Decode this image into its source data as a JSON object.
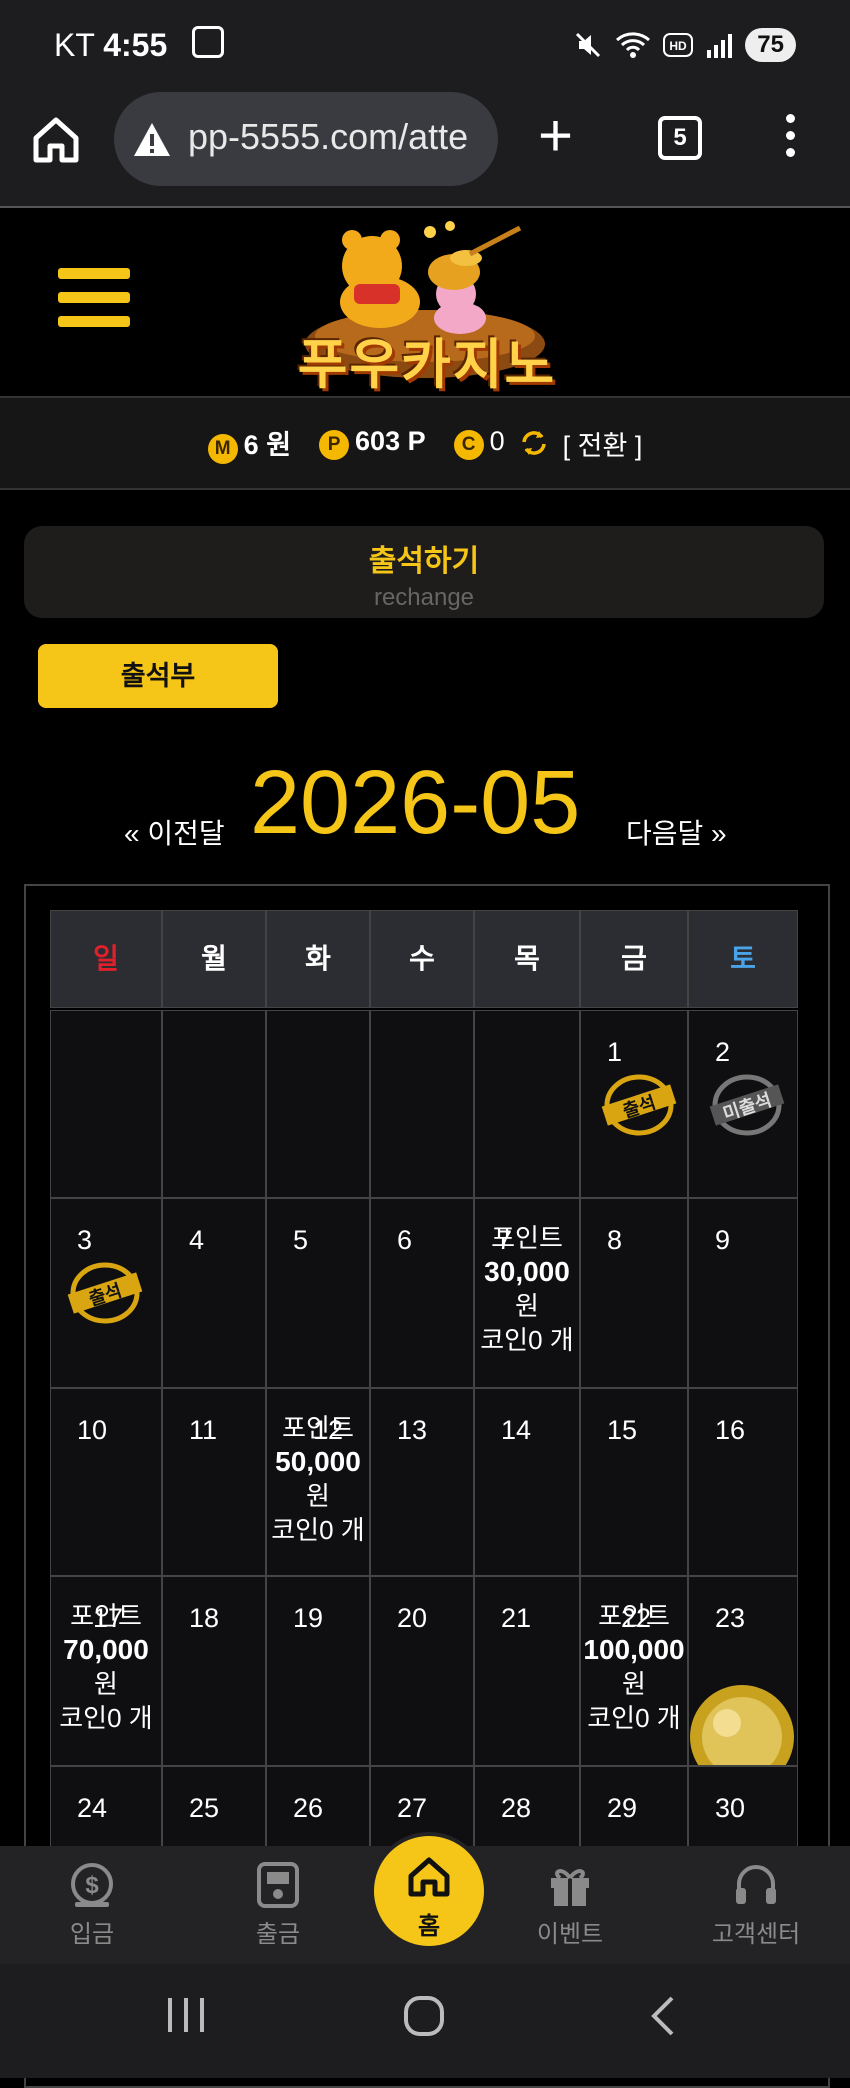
{
  "status_bar": {
    "carrier": "KT",
    "time": "4:55",
    "battery": "75"
  },
  "browser": {
    "url": "pp-5555.com/atte",
    "tab_count": "5"
  },
  "site": {
    "logo_text": "푸우카지노"
  },
  "balance": {
    "money_badge": "M",
    "money_value": "6",
    "money_unit": "원",
    "point_badge": "P",
    "point_value": "603",
    "point_unit": "P",
    "coin_badge": "C",
    "coin_value": "0",
    "switch_label": "[ 전환 ]"
  },
  "attendance": {
    "title": "출석하기",
    "subtitle": "rechange",
    "button_label": "출석부"
  },
  "month_nav": {
    "prev": "« 이전달",
    "current": "2026-05",
    "next": "다음달 »"
  },
  "calendar": {
    "weekdays": [
      "일",
      "월",
      "화",
      "수",
      "목",
      "금",
      "토"
    ],
    "days": {
      "d1": "1",
      "d2": "2",
      "d3": "3",
      "d4": "4",
      "d5": "5",
      "d6": "6",
      "d7": "7",
      "d8": "8",
      "d9": "9",
      "d10": "10",
      "d11": "11",
      "d12": "12",
      "d13": "13",
      "d14": "14",
      "d15": "15",
      "d16": "16",
      "d17": "17",
      "d18": "18",
      "d19": "19",
      "d20": "20",
      "d21": "21",
      "d22": "22",
      "d23": "23",
      "d24": "24",
      "d25": "25",
      "d26": "26",
      "d27": "27",
      "d28": "28",
      "d29": "29",
      "d30": "30"
    },
    "stamps": {
      "attended": "출석",
      "not_attended": "미출석"
    },
    "events": {
      "e7": {
        "line1": "포인트",
        "amount": "30,000",
        "unit": "원",
        "coin": "코인0 개"
      },
      "e12": {
        "line1": "포인트",
        "amount": "50,000",
        "unit": "원",
        "coin": "코인0 개"
      },
      "e17": {
        "line1": "포인트",
        "amount": "70,000",
        "unit": "원",
        "coin": "코인0 개"
      },
      "e22": {
        "line1": "포인트",
        "amount": "100,000",
        "unit": "원",
        "coin": "코인0 개"
      }
    }
  },
  "bottom_nav": {
    "deposit": "입금",
    "withdraw": "출금",
    "home": "홈",
    "event": "이벤트",
    "support": "고객센터"
  },
  "colors": {
    "accent": "#f5c518",
    "sunday": "#e0202a",
    "saturday": "#4aa3e8"
  }
}
